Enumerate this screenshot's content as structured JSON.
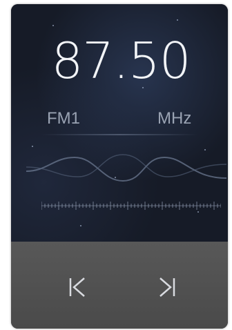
{
  "radio": {
    "frequency": "87.50",
    "band": "FM1",
    "unit": "MHz"
  },
  "controls": {
    "prev_icon": "skip-previous-icon",
    "next_icon": "skip-next-icon"
  },
  "colors": {
    "screen_bg": "#161b27",
    "text_primary": "#f2f4f7",
    "text_secondary": "#9aa3b3",
    "controls_bg": "#4f4f4f",
    "icon": "#d9dbe0"
  }
}
